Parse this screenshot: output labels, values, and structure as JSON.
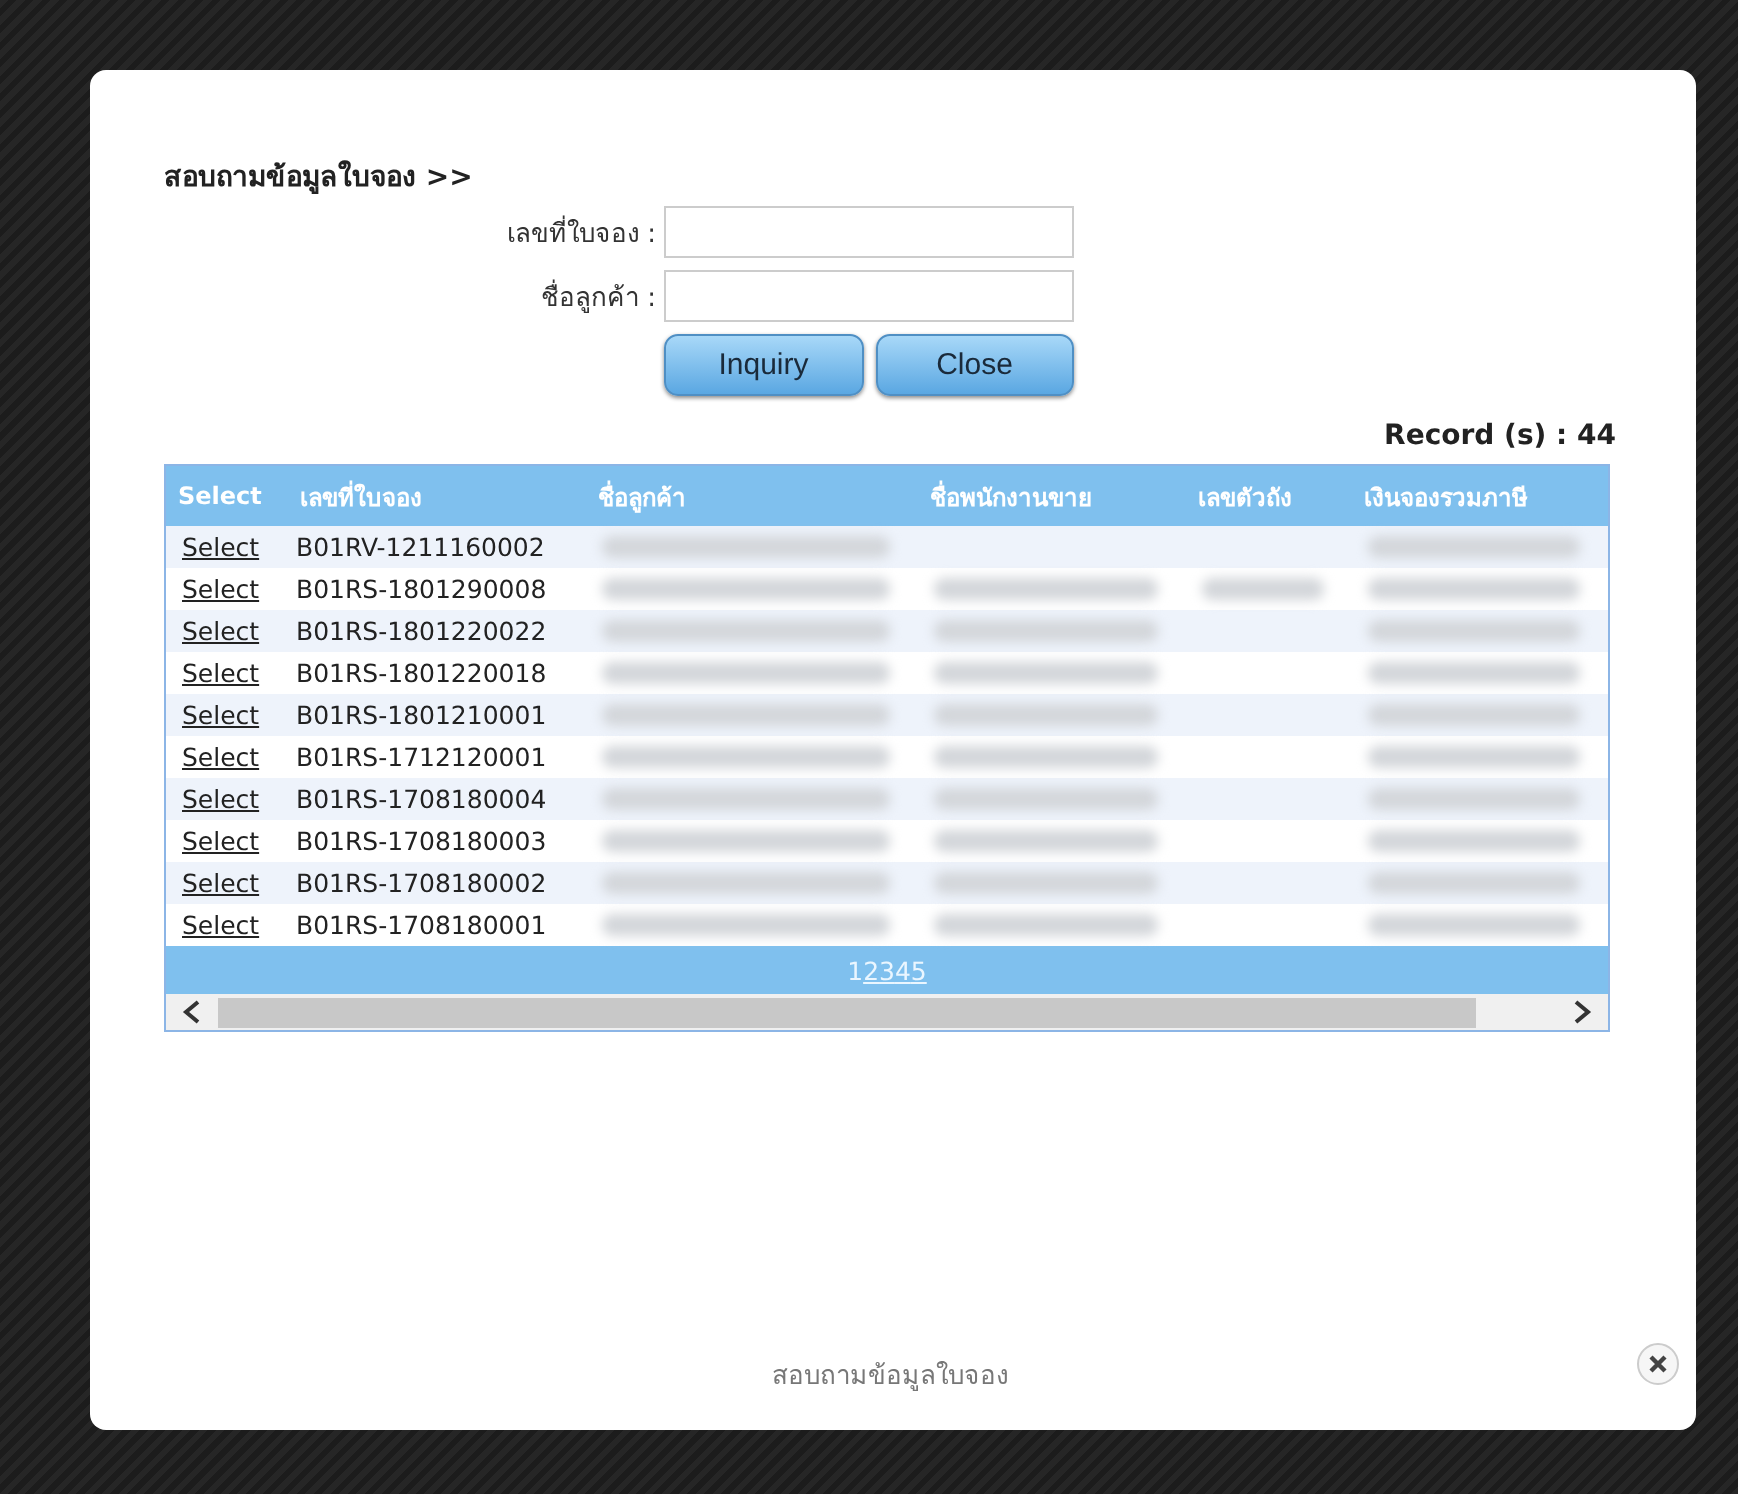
{
  "form": {
    "title": "สอบถามข้อมูลใบจอง >>",
    "fields": [
      {
        "label": "เลขที่ใบจอง :"
      },
      {
        "label": "ชื่อลูกค้า :"
      }
    ],
    "buttons": [
      "Inquiry",
      "Close"
    ]
  },
  "record_count": "Record (s) : 44",
  "table": {
    "columns": [
      "Select",
      "เลขที่ใบจอง",
      "ชื่อลูกค้า",
      "ชื่อพนักงานขาย",
      "เลขตัวถัง",
      "เงินจองรวมภาษี"
    ],
    "rows": [
      {
        "link": "Select",
        "number": "B01RV-1211160002",
        "redacted": [
          true,
          false,
          false,
          true
        ]
      },
      {
        "link": "Select",
        "number": "B01RS-1801290008",
        "redacted": [
          true,
          true,
          true,
          true
        ]
      },
      {
        "link": "Select",
        "number": "B01RS-1801220022",
        "redacted": [
          true,
          true,
          false,
          true
        ]
      },
      {
        "link": "Select",
        "number": "B01RS-1801220018",
        "redacted": [
          true,
          true,
          false,
          true
        ]
      },
      {
        "link": "Select",
        "number": "B01RS-1801210001",
        "redacted": [
          true,
          true,
          false,
          true
        ]
      },
      {
        "link": "Select",
        "number": "B01RS-1712120001",
        "redacted": [
          true,
          true,
          false,
          true
        ]
      },
      {
        "link": "Select",
        "number": "B01RS-1708180004",
        "redacted": [
          true,
          true,
          false,
          true
        ]
      },
      {
        "link": "Select",
        "number": "B01RS-1708180003",
        "redacted": [
          true,
          true,
          false,
          true
        ]
      },
      {
        "link": "Select",
        "number": "B01RS-1708180002",
        "redacted": [
          true,
          true,
          false,
          true
        ]
      },
      {
        "link": "Select",
        "number": "B01RS-1708180001",
        "redacted": [
          true,
          true,
          false,
          true
        ]
      }
    ],
    "pages": [
      {
        "label": "1",
        "selected": true
      },
      {
        "label": "2",
        "selected": false
      },
      {
        "label": "3",
        "selected": false
      },
      {
        "label": "4",
        "selected": false
      },
      {
        "label": "5",
        "selected": false
      }
    ]
  },
  "footer": {
    "caption": "สอบถามข้อมูลใบจอง"
  }
}
